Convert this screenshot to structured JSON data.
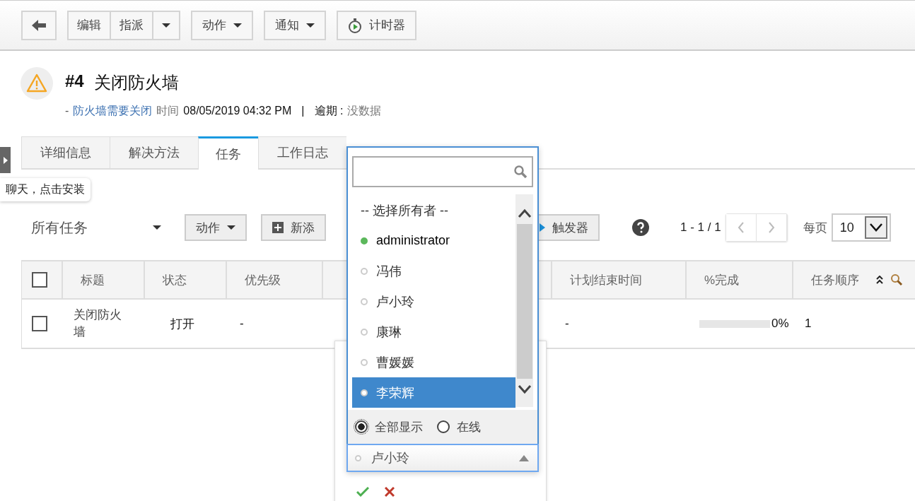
{
  "toolbar": {
    "back": {
      "kind": "back"
    },
    "edit": "编辑",
    "assign": "指派",
    "actions": "动作",
    "notify": "通知",
    "timer": "计时器"
  },
  "header": {
    "number": "#4",
    "title": "关闭防火墙",
    "prefix": "-",
    "link": "防火墙需要关闭",
    "time_label": "时间",
    "time": "08/05/2019 04:32 PM",
    "separator": "|",
    "due_label": "逾期 :",
    "due_value": "没数据"
  },
  "tabs": [
    {
      "label": "详细信息",
      "selected": false
    },
    {
      "label": "解决方法",
      "selected": false
    },
    {
      "label": "任务",
      "selected": true
    },
    {
      "label": "工作日志",
      "selected": false
    }
  ],
  "chat_tooltip": "聊天，点击安装",
  "task_toolbar": {
    "view": "所有任务",
    "actions": "动作",
    "new": "新添",
    "trigger": "触发器",
    "range": "1 - 1 / 1",
    "per_page_label": "每页",
    "per_page": "10"
  },
  "table": {
    "select_all": {
      "checked": false
    },
    "columns": [
      "标题",
      "状态",
      "优先级",
      "计划结束时间",
      "%完成",
      "任务顺序"
    ],
    "rows": [
      {
        "checked": false,
        "title": "关闭防火墙",
        "status": "打开",
        "priority": "-",
        "end_time": "-",
        "progress": {
          "level": 0,
          "text": "0%"
        },
        "order": "1"
      }
    ]
  },
  "owner_dropdown": {
    "options": [
      {
        "kind": "header",
        "name": "-- 选择所有者 --",
        "selected": false
      },
      {
        "kind": "user",
        "name": "administrator",
        "online": true,
        "selected": false
      },
      {
        "kind": "user",
        "name": "冯伟",
        "online": false,
        "selected": false
      },
      {
        "kind": "user",
        "name": "卢小玲",
        "online": false,
        "selected": false
      },
      {
        "kind": "user",
        "name": "康琳",
        "online": false,
        "selected": false
      },
      {
        "kind": "user",
        "name": "曹媛媛",
        "online": false,
        "selected": false
      },
      {
        "kind": "user",
        "name": "李荣辉",
        "online": false,
        "selected": true
      }
    ],
    "filters": [
      {
        "label": "全部显示",
        "selected": true
      },
      {
        "label": "在线",
        "selected": false
      }
    ],
    "current": {
      "name": "卢小玲",
      "online": false
    }
  }
}
